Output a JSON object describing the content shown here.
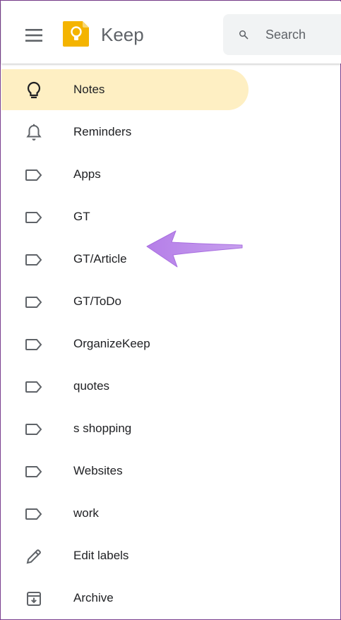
{
  "header": {
    "app_title": "Keep",
    "search_placeholder": "Search"
  },
  "icons": {
    "menu": "hamburger-menu-icon",
    "logo": "keep-lightbulb-logo",
    "search": "search-icon"
  },
  "colors": {
    "active_bg": "#feefc3",
    "logo_yellow": "#f4b400",
    "icon_gray": "#5f6368",
    "annotation_arrow": "#bb86e8"
  },
  "sidebar": {
    "items": [
      {
        "label": "Notes",
        "icon": "lightbulb-icon",
        "active": true
      },
      {
        "label": "Reminders",
        "icon": "bell-icon",
        "active": false
      },
      {
        "label": "Apps",
        "icon": "label-icon",
        "active": false
      },
      {
        "label": "GT",
        "icon": "label-icon",
        "active": false
      },
      {
        "label": "GT/Article",
        "icon": "label-icon",
        "active": false
      },
      {
        "label": "GT/ToDo",
        "icon": "label-icon",
        "active": false
      },
      {
        "label": "OrganizeKeep",
        "icon": "label-icon",
        "active": false
      },
      {
        "label": "quotes",
        "icon": "label-icon",
        "active": false
      },
      {
        "label": "s shopping",
        "icon": "label-icon",
        "active": false
      },
      {
        "label": "Websites",
        "icon": "label-icon",
        "active": false
      },
      {
        "label": "work",
        "icon": "label-icon",
        "active": false
      },
      {
        "label": "Edit labels",
        "icon": "pencil-icon",
        "active": false
      },
      {
        "label": "Archive",
        "icon": "archive-icon",
        "active": false
      }
    ]
  }
}
